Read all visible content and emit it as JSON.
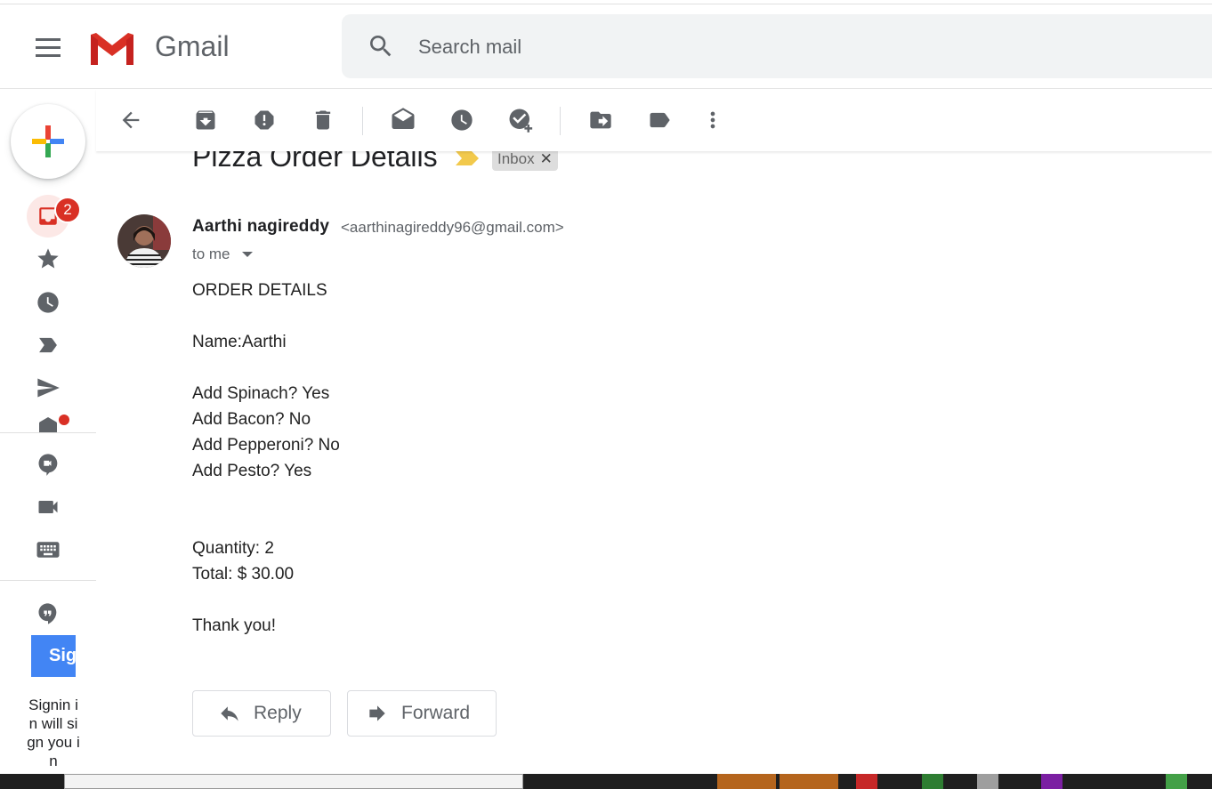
{
  "app": {
    "name": "Gmail"
  },
  "colors": {
    "accent_red": "#d93025",
    "blue": "#4285f4",
    "gray_text": "#5f6368",
    "search_bg": "#f1f3f4"
  },
  "search": {
    "placeholder": "Search mail"
  },
  "sidebar": {
    "inbox_badge": "2",
    "icons": [
      "inbox-icon",
      "star-icon",
      "clock-icon",
      "label-important-icon",
      "send-icon",
      "draft-icon",
      "meet-icon",
      "video-icon",
      "keyboard-icon",
      "hangouts-icon"
    ],
    "signin_button": "Sig",
    "signin_text": "Signin in will sign you in"
  },
  "toolbar": {
    "icons": [
      "back-icon",
      "archive-icon",
      "report-spam-icon",
      "delete-icon",
      "mark-unread-icon",
      "snooze-icon",
      "add-to-tasks-icon",
      "move-to-icon",
      "labels-icon",
      "more-icon"
    ]
  },
  "message": {
    "subject": "Pizza Order Details",
    "label_chip": "Inbox",
    "sender_name": "Aarthi nagireddy",
    "sender_email": "<aarthinagireddy96@gmail.com>",
    "recipient": "to me",
    "body": {
      "heading": "ORDER DETAILS",
      "name": "Name:Aarthi",
      "spinach": "Add Spinach? Yes",
      "bacon": "Add Bacon? No",
      "pepperoni": "Add Pepperoni? No",
      "pesto": "Add Pesto? Yes",
      "quantity": "Quantity: 2",
      "total": "Total: $ 30.00",
      "closing": "Thank you!"
    }
  },
  "actions": {
    "reply": "Reply",
    "forward": "Forward"
  }
}
